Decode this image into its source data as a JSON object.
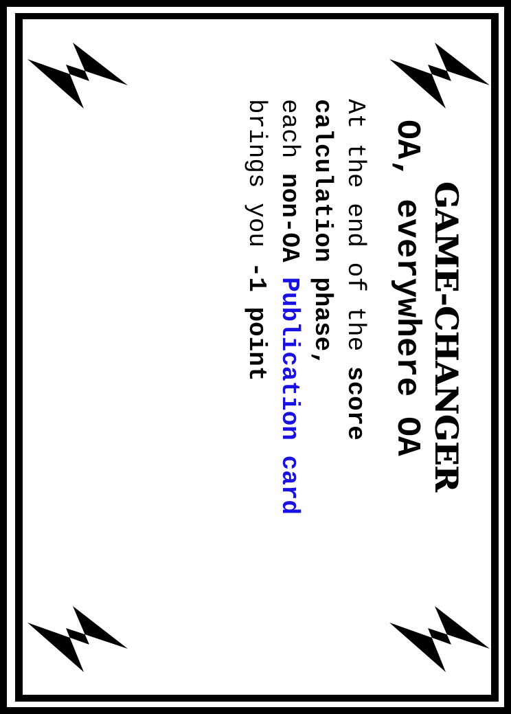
{
  "card": {
    "type_title": "GAME-CHANGER",
    "name": "OA, everywhere OA",
    "body": {
      "line1_a": "At the end of the ",
      "line1_b": "score",
      "line2": "calculation phase,",
      "line3_a": "each ",
      "line3_b": "non-OA",
      "line3_sp": " ",
      "line3_c": "Publication card",
      "line4_a": "brings you ",
      "line4_b": "-1 point"
    }
  },
  "colors": {
    "border": "#000000",
    "background": "#ffffff",
    "highlight": "#1a10e0"
  },
  "icons": [
    "lightning-bolt-icon",
    "lightning-bolt-icon",
    "lightning-bolt-icon",
    "lightning-bolt-icon"
  ]
}
